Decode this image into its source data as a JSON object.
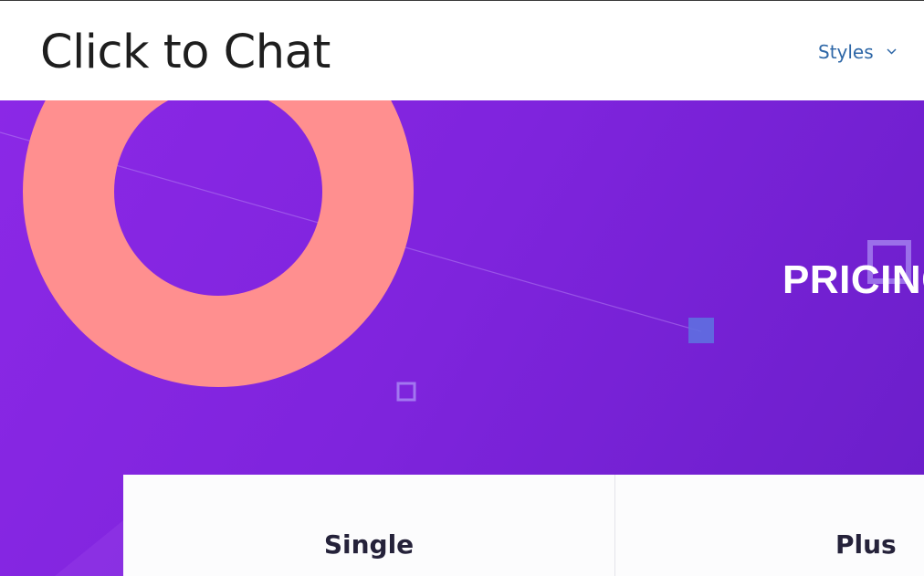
{
  "header": {
    "site_title": "Click to Chat",
    "menu": {
      "styles_label": "Styles",
      "styles_icon": "chevron-down-icon"
    }
  },
  "hero": {
    "title": "PRICING",
    "colors": {
      "background_start": "#8b28e6",
      "background_end": "#6a1ec9",
      "ring": "#ff8f8f",
      "square_fill": "#5f6fe0",
      "square_outline": "#a277f0"
    }
  },
  "pricing": {
    "plans": [
      {
        "name": "Single"
      },
      {
        "name": "Plus"
      }
    ]
  }
}
